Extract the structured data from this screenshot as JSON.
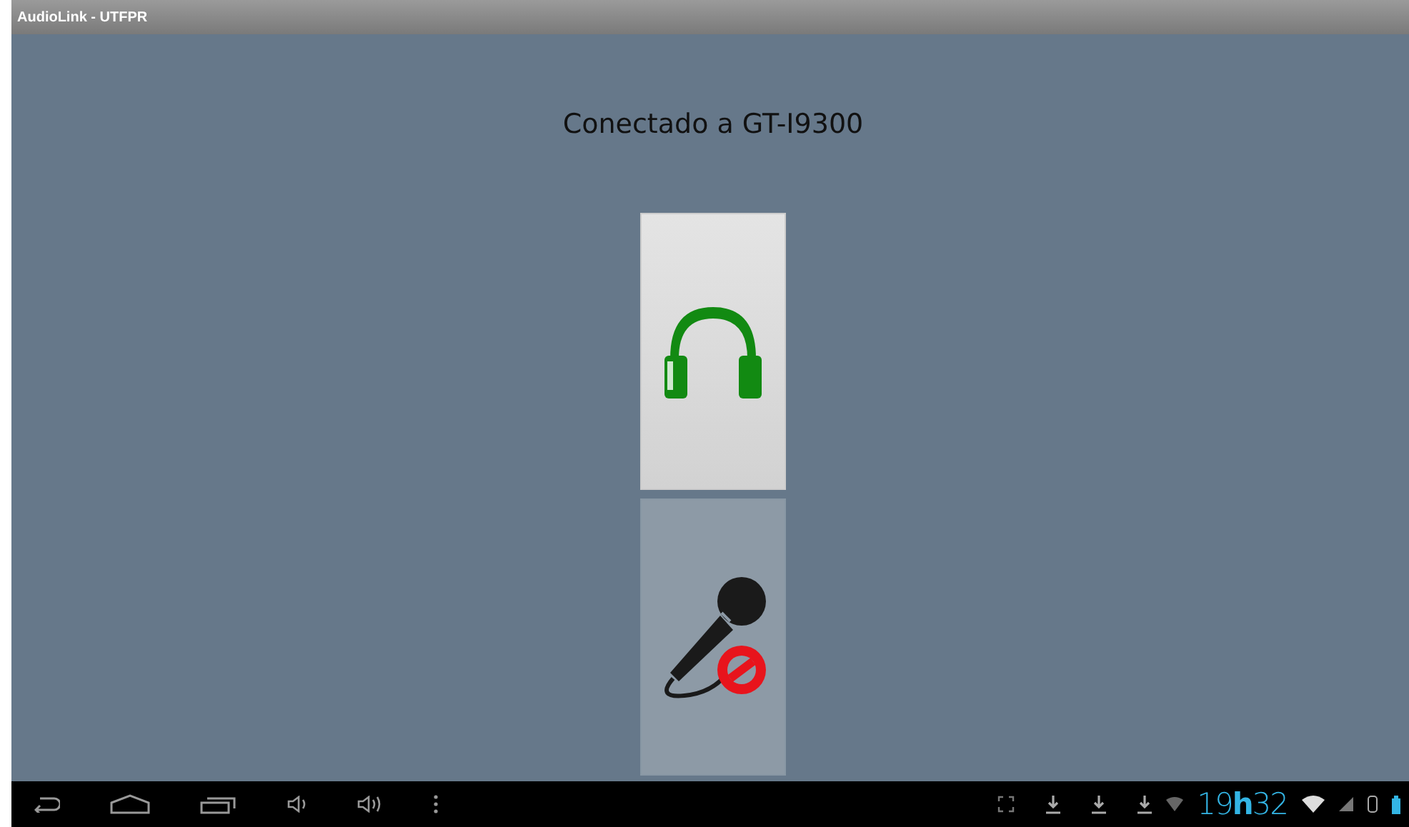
{
  "window": {
    "title": "AudioLink - UTFPR"
  },
  "status": "Conectado a GT-I9300",
  "buttons": [
    {
      "kind": "headphones",
      "on": true
    },
    {
      "kind": "microphone",
      "on": false
    }
  ],
  "system_bar": {
    "clock": "19**h**32"
  }
}
